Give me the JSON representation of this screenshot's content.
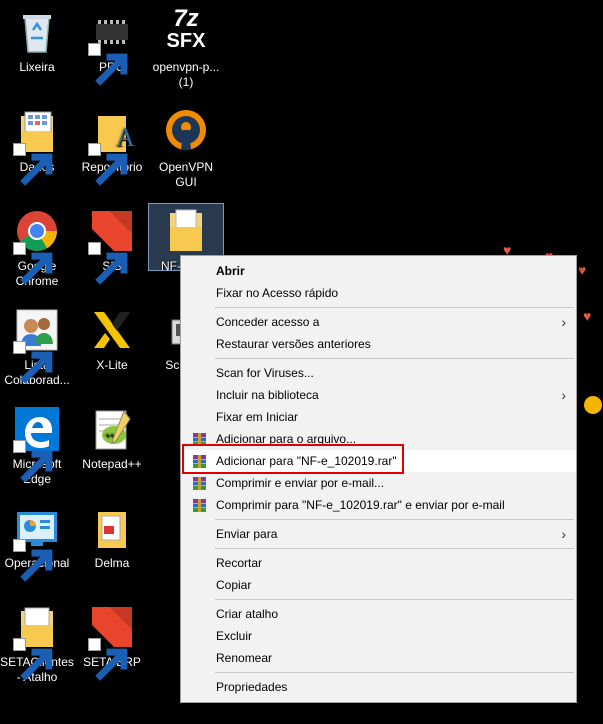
{
  "desktop": {
    "icons": [
      {
        "label": "Lixeira"
      },
      {
        "label": "PRG"
      },
      {
        "label": "openvpn-p...\n(1)"
      },
      {
        "label": "Dados"
      },
      {
        "label": "Repositorio"
      },
      {
        "label": "OpenVPN\nGUI"
      },
      {
        "label": "Google\nChrome"
      },
      {
        "label": "SIS"
      },
      {
        "label": "NF-e_1..."
      },
      {
        "label": "Lista\nColaborad..."
      },
      {
        "label": "X-Lite"
      },
      {
        "label": "Scree..."
      },
      {
        "label": "Microsoft\nEdge"
      },
      {
        "label": "Notepad++"
      },
      {
        "label": "Operacional"
      },
      {
        "label": "Delma"
      },
      {
        "label": "SETAClientes\n- Atalho"
      },
      {
        "label": "SETA ERP"
      }
    ],
    "sfx_text": {
      "top": "7z",
      "bottom": "SFX"
    }
  },
  "context_menu": {
    "items": [
      {
        "label": "Abrir"
      },
      {
        "label": "Fixar no Acesso rápido"
      },
      {
        "label": "Conceder acesso a"
      },
      {
        "label": "Restaurar versões anteriores"
      },
      {
        "label": "Scan for Viruses..."
      },
      {
        "label": "Incluir na biblioteca"
      },
      {
        "label": "Fixar em Iniciar"
      },
      {
        "label": "Adicionar para o arquivo..."
      },
      {
        "label": "Adicionar para \"NF-e_102019.rar\""
      },
      {
        "label": "Comprimir e enviar por e-mail..."
      },
      {
        "label": "Comprimir para \"NF-e_102019.rar\" e enviar por e-mail"
      },
      {
        "label": "Enviar para"
      },
      {
        "label": "Recortar"
      },
      {
        "label": "Copiar"
      },
      {
        "label": "Criar atalho"
      },
      {
        "label": "Excluir"
      },
      {
        "label": "Renomear"
      },
      {
        "label": "Propriedades"
      }
    ]
  },
  "colors": {
    "menu_bg": "#f2f2f2",
    "highlight_box": "#e00000",
    "desktop_bg": "#000000"
  }
}
